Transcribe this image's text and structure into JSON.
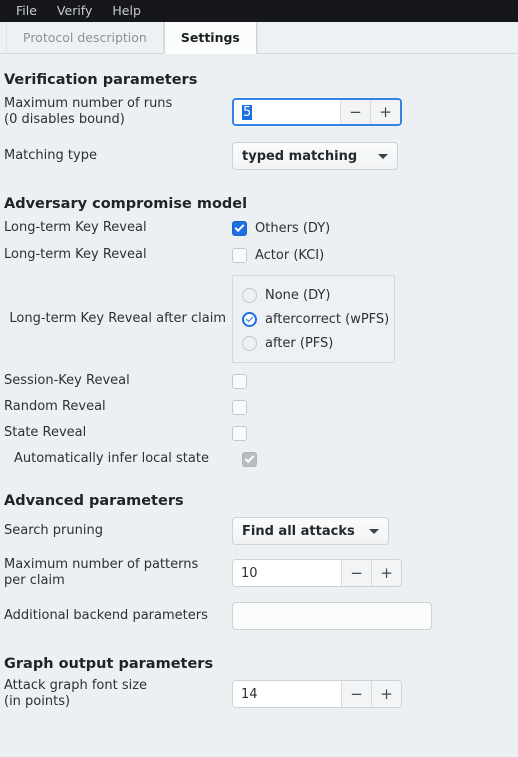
{
  "menubar": {
    "items": [
      {
        "label": "File"
      },
      {
        "label": "Verify"
      },
      {
        "label": "Help"
      }
    ]
  },
  "tabs": [
    {
      "label": "Protocol description",
      "active": false
    },
    {
      "label": "Settings",
      "active": true
    }
  ],
  "sections": {
    "verification": {
      "title": "Verification parameters",
      "max_runs": {
        "label_line1": "Maximum number of runs",
        "label_line2": "(0 disables bound)",
        "value": "5",
        "minus": "−",
        "plus": "+"
      },
      "matching_type": {
        "label": "Matching type",
        "value": "typed matching"
      }
    },
    "adversary": {
      "title": "Adversary compromise model",
      "ltk_others": {
        "label": "Long-term Key Reveal",
        "option": "Others (DY)",
        "checked": true
      },
      "ltk_actor": {
        "label": "Long-term Key Reveal",
        "option": "Actor (KCI)",
        "checked": false
      },
      "ltk_after_claim": {
        "label": "Long-term Key Reveal after claim",
        "options": [
          {
            "label": "None (DY)",
            "selected": false
          },
          {
            "label": "aftercorrect (wPFS)",
            "selected": true
          },
          {
            "label": "after (PFS)",
            "selected": false
          }
        ]
      },
      "session_key_reveal": {
        "label": "Session-Key Reveal",
        "checked": false
      },
      "random_reveal": {
        "label": "Random Reveal",
        "checked": false
      },
      "state_reveal": {
        "label": "State Reveal",
        "checked": false
      },
      "auto_infer_local_state": {
        "label": "Automatically infer local state",
        "checked": true,
        "disabled": true
      }
    },
    "advanced": {
      "title": "Advanced parameters",
      "search_pruning": {
        "label": "Search pruning",
        "value": "Find all attacks"
      },
      "max_patterns": {
        "label_line1": "Maximum number of patterns",
        "label_line2": "per claim",
        "value": "10",
        "minus": "−",
        "plus": "+"
      },
      "backend_params": {
        "label": "Additional backend parameters",
        "value": "",
        "placeholder": ""
      }
    },
    "graph": {
      "title": "Graph output parameters",
      "font_size": {
        "label_line1": "Attack graph font size",
        "label_line2": "(in points)",
        "value": "14",
        "minus": "−",
        "plus": "+"
      }
    }
  }
}
